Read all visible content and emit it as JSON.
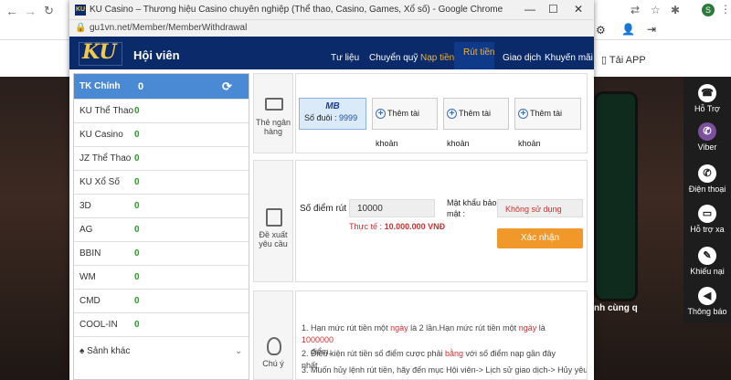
{
  "popup": {
    "title": "KU Casino – Thương hiệu Casino chuyên nghiệp (Thể thao, Casino, Games, Xổ số) - Google Chrome",
    "url": "gu1vn.net/Member/MemberWithdrawal"
  },
  "header": {
    "logo": "KU",
    "title": "Hội viên",
    "nav": [
      "Tư liệu",
      "Chuyển quỹ",
      "Nạp tiền",
      "Rút tiền",
      "Giao dịch",
      "Khuyến mãi"
    ],
    "active_nav": "Rút tiền"
  },
  "sidebar": {
    "main": {
      "label": "TK Chính",
      "value": "0"
    },
    "items": [
      {
        "label": "KU Thể Thao",
        "value": "0"
      },
      {
        "label": "KU Casino",
        "value": "0"
      },
      {
        "label": "JZ Thể Thao",
        "value": "0"
      },
      {
        "label": "KU Xổ Số",
        "value": "0"
      },
      {
        "label": "3D",
        "value": "0"
      },
      {
        "label": "AG",
        "value": "0"
      },
      {
        "label": "BBIN",
        "value": "0"
      },
      {
        "label": "WM",
        "value": "0"
      },
      {
        "label": "CMD",
        "value": "0"
      },
      {
        "label": "COOL-IN",
        "value": "0"
      }
    ],
    "more": "Sảnh khác"
  },
  "bank_section": {
    "label": "Thẻ ngân hàng",
    "selected_card": {
      "brand": "MB",
      "suffix_label": "Số đuôi :",
      "suffix": "9999"
    },
    "add_buttons": [
      "Thêm tài khoản",
      "Thêm tài khoản",
      "Thêm tài khoản"
    ]
  },
  "withdraw_section": {
    "label": "Đề xuất yêu cầu",
    "points_label": "Số điểm rút :",
    "points_value": "10000",
    "actual_label": "Thực tế :",
    "actual_value": "10.000.000 VNĐ",
    "password_label": "Mật khẩu bảo mật :",
    "password_placeholder": "Không sử dụng",
    "confirm_label": "Xác nhận"
  },
  "notes_section": {
    "label": "Chú ý",
    "notes": [
      {
        "parts": [
          "Hạn mức rút tiền một ",
          "ngày",
          " là 2 lần.Hạn mức rút tiền một ",
          "ngày",
          " là ",
          "1000000",
          " điểm."
        ]
      },
      {
        "parts": [
          "Điều kiện rút tiền số điểm cược phải ",
          "bằng",
          " với số điểm nạp gần đây nhất."
        ]
      },
      {
        "parts": [
          "Muốn hủy lệnh rút tiền, hãy đến mục Hội viên-> Lịch sử giao dịch-> Hủy yêu"
        ]
      }
    ]
  },
  "background": {
    "app_label": "Tải APP",
    "rail": [
      "Hỗ Trợ",
      "Viber",
      "Điện thoại",
      "Hỗ trợ xa",
      "Khiếu nại",
      "Thông báo"
    ],
    "promo_text": "nh cùng q"
  },
  "colors": {
    "header": "#0a2a6a",
    "active": "#f2b233",
    "confirm": "#f0982a",
    "sidebar_active": "#4a8ad4"
  }
}
